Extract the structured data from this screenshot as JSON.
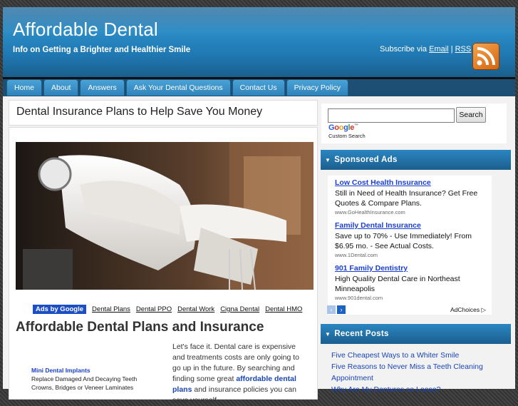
{
  "site": {
    "title": "Affordable Dental",
    "tagline": "Info on Getting a Brighter and Healthier Smile",
    "subscribe_prefix": "Subscribe via",
    "subscribe_email": "Email",
    "subscribe_sep": "|",
    "subscribe_rss": "RSS"
  },
  "nav": {
    "tabs": [
      "Home",
      "About",
      "Answers",
      "Ask Your Dental Questions",
      "Contact Us",
      "Privacy Policy"
    ]
  },
  "post": {
    "title": "Dental Insurance Plans to Help Save You Money",
    "heading": "Affordable Dental Plans and Insurance",
    "body_1": "Let's face it.  Dental care is expensive and treatments costs are only going to go up in the future.  By searching and finding some great ",
    "body_link": "affordable dental plans",
    "body_2": " and insurance policies you can save yourself"
  },
  "adlinks": {
    "ads_by": "Ads by Google",
    "links": [
      "Dental Plans",
      "Dental PPO",
      "Dental Work",
      "Cigna Dental",
      "Dental HMO"
    ]
  },
  "mini_ad": {
    "title": "Mini Dental Implants",
    "line1": "Replace Damaged And Decaying Teeth",
    "line2": "Crowns, Bridges or Veneer Laminates"
  },
  "search": {
    "button": "Search",
    "brand": "Google",
    "custom": "Custom Search",
    "value": ""
  },
  "sponsored": {
    "heading": "Sponsored Ads",
    "ads": [
      {
        "title": "Low Cost Health Insurance",
        "desc": "Still in Need of Health Insurance? Get Free Quotes & Compare Plans.",
        "url": "www.GoHealthInsurance.com"
      },
      {
        "title": "Family Dental Insurance",
        "desc": "Save up to 70% - Use Immediately! From $6.95 mo. - See Actual Costs.",
        "url": "www.1Dental.com"
      },
      {
        "title": "901 Family Dentistry",
        "desc": "High Quality Dental Care in Northeast Minneapolis",
        "url": "www.901dental.com"
      }
    ],
    "adchoices": "AdChoices"
  },
  "recent": {
    "heading": "Recent Posts",
    "posts": [
      "Five Cheapest Ways to a Whiter Smile",
      "Five Reasons to Never Miss a Teeth Cleaning Appointment",
      "Why Are My Dentures so Loose?"
    ]
  },
  "colors": {
    "accent": "#2a8bc4",
    "nav_tab": "#3b93c9",
    "link": "#1a45b8"
  }
}
